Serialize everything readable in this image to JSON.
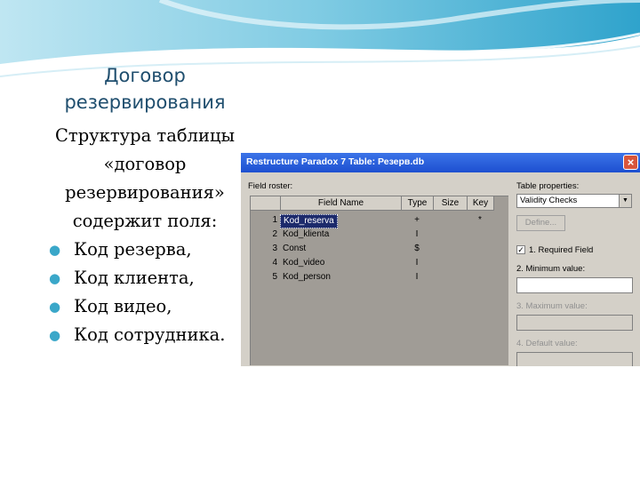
{
  "slide": {
    "title_line1": "Договор",
    "title_line2": "резервирования",
    "body_lines": [
      "Структура таблицы",
      "«договор",
      "резервирования»",
      "содержит поля:"
    ],
    "bullets": [
      "Код резерва,",
      "Код клиента,",
      "Код видео,",
      "Код сотрудника."
    ]
  },
  "dialog": {
    "title": "Restructure Paradox 7 Table: Резерв.db",
    "close": "×",
    "field_roster_label": "Field roster:",
    "columns": [
      "Field Name",
      "Type",
      "Size",
      "Key"
    ],
    "rows": [
      {
        "num": "1",
        "name": "Kod_reserva",
        "type": "+",
        "key": "*"
      },
      {
        "num": "2",
        "name": "Kod_klienta",
        "type": "I",
        "key": ""
      },
      {
        "num": "3",
        "name": "Const",
        "type": "$",
        "key": ""
      },
      {
        "num": "4",
        "name": "Kod_video",
        "type": "I",
        "key": ""
      },
      {
        "num": "5",
        "name": "Kod_person",
        "type": "I",
        "key": ""
      }
    ],
    "table_properties_label": "Table properties:",
    "table_properties_value": "Validity Checks",
    "define_label": "Define...",
    "required_label": "1. Required Field",
    "required_checked": "✓",
    "minimum_label": "2. Minimum value:",
    "maximum_label": "3. Maximum value:",
    "default_label": "4. Default value:"
  }
}
